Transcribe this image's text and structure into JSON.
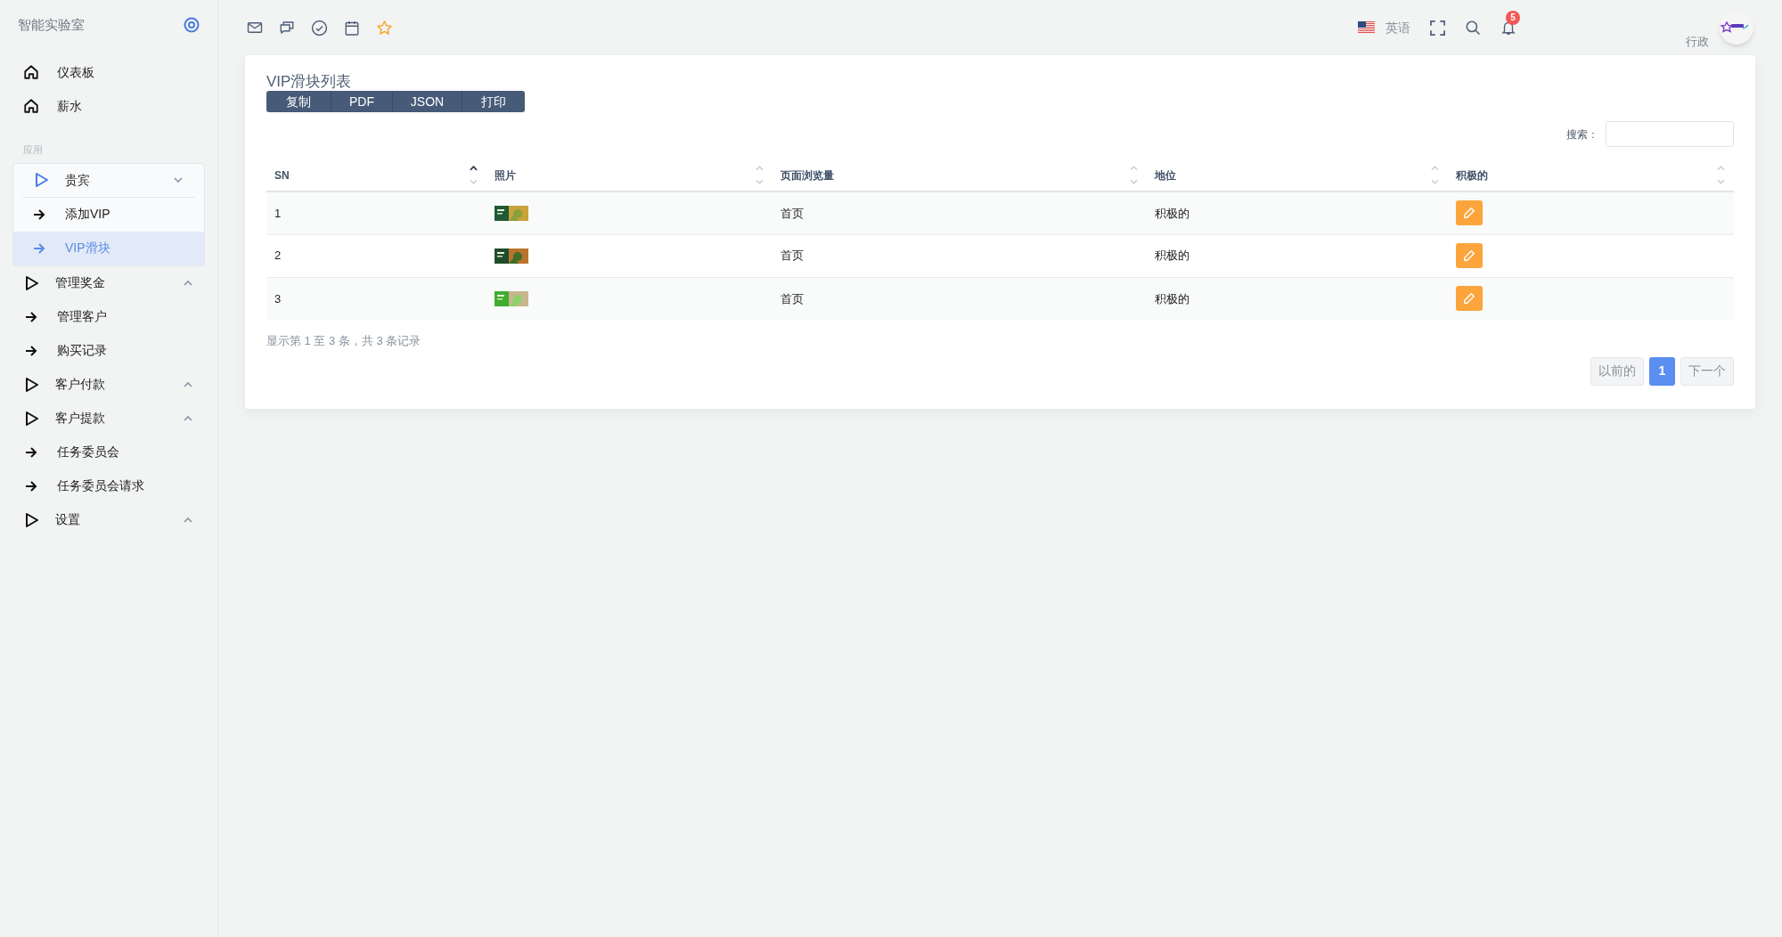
{
  "sidebar": {
    "brand": "智能实验室",
    "items": [
      {
        "kind": "link",
        "label": "仪表板"
      },
      {
        "kind": "link",
        "label": "薪水"
      },
      {
        "kind": "header",
        "label": "应用"
      },
      {
        "kind": "group",
        "label": "贵宾",
        "expanded": true,
        "children": [
          {
            "label": "添加VIP",
            "selected": false
          },
          {
            "label": "VIP滑块",
            "selected": true
          }
        ]
      },
      {
        "kind": "group",
        "label": "管理奖金",
        "expanded": false
      },
      {
        "kind": "item",
        "label": "管理客户"
      },
      {
        "kind": "item",
        "label": "购买记录"
      },
      {
        "kind": "group",
        "label": "客户付款",
        "expanded": false
      },
      {
        "kind": "group",
        "label": "客户提款",
        "expanded": false
      },
      {
        "kind": "item",
        "label": "任务委员会"
      },
      {
        "kind": "item",
        "label": "任务委员会请求"
      },
      {
        "kind": "group",
        "label": "设置",
        "expanded": false
      }
    ]
  },
  "topbar": {
    "language": "英语",
    "notification_count": "5",
    "user": "行政"
  },
  "card": {
    "title": "VIP滑块列表",
    "export_buttons": [
      "复制",
      "PDF",
      "JSON",
      "打印"
    ],
    "search_label": "搜索：",
    "table": {
      "columns": [
        {
          "label": "SN",
          "sorted_ascending": true
        },
        {
          "label": "照片",
          "sorted_ascending": false
        },
        {
          "label": "页面浏览量",
          "sorted_ascending": false
        },
        {
          "label": "地位",
          "sorted_ascending": false
        },
        {
          "label": "积极的",
          "sorted_ascending": false
        }
      ],
      "rows": [
        {
          "sn": "1",
          "page": "首页",
          "status": "积极的"
        },
        {
          "sn": "2",
          "page": "首页",
          "status": "积极的"
        },
        {
          "sn": "3",
          "page": "首页",
          "status": "积极的"
        }
      ]
    },
    "info": "显示第 1 至 3 条，共 3 条记录",
    "pagination": {
      "previous": {
        "label": "以前的",
        "disabled": true
      },
      "pages": [
        {
          "label": "1",
          "selected": true
        }
      ],
      "next": {
        "label": "下一个",
        "disabled": true
      }
    }
  }
}
